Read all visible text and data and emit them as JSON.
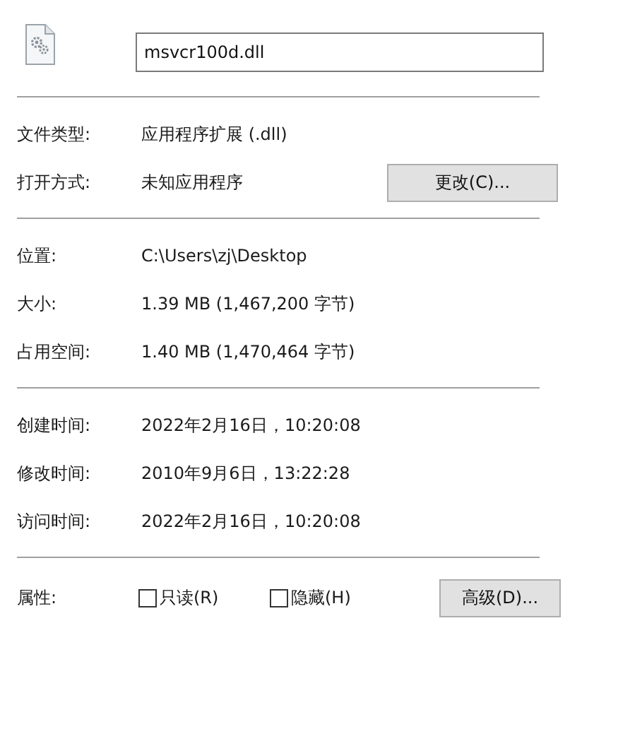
{
  "file": {
    "name": "msvcr100d.dll"
  },
  "type_rows": [
    {
      "label": "文件类型:",
      "value": "应用程序扩展 (.dll)"
    },
    {
      "label": "打开方式:",
      "value": "未知应用程序",
      "button": "更改(C)..."
    }
  ],
  "location_rows": [
    {
      "label": "位置:",
      "value": "C:\\Users\\zj\\Desktop"
    },
    {
      "label": "大小:",
      "value": "1.39 MB (1,467,200 字节)"
    },
    {
      "label": "占用空间:",
      "value": "1.40 MB (1,470,464 字节)"
    }
  ],
  "time_rows": [
    {
      "label": "创建时间:",
      "value": "2022年2月16日，10:20:08"
    },
    {
      "label": "修改时间:",
      "value": "2010年9月6日，13:22:28"
    },
    {
      "label": "访问时间:",
      "value": "2022年2月16日，10:20:08"
    }
  ],
  "attributes": {
    "label": "属性:",
    "checkboxes": [
      {
        "label": "只读(R)",
        "checked": false
      },
      {
        "label": "隐藏(H)",
        "checked": false
      }
    ],
    "button": "高级(D)..."
  }
}
